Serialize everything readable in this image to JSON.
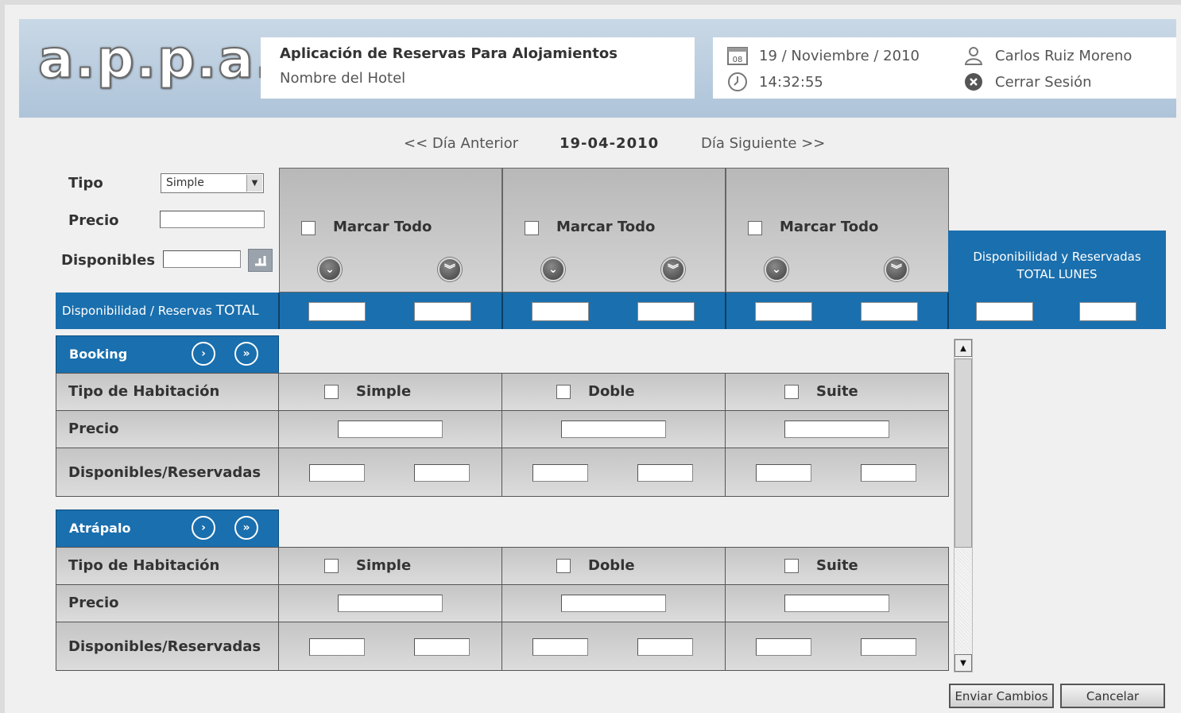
{
  "header": {
    "logo": "a.p.p.a.",
    "app_title": "Aplicación de Reservas Para Alojamientos",
    "hotel_name": "Nombre del Hotel",
    "calendar_day": "08",
    "date": "19 / Noviembre / 2010",
    "time": "14:32:55",
    "user": "Carlos Ruiz Moreno",
    "logout": "Cerrar Sesión"
  },
  "nav": {
    "prev": "<< Día Anterior",
    "date": "19-04-2010",
    "next": "Día Siguiente >>"
  },
  "filter": {
    "tipo_label": "Tipo",
    "tipo_value": "Simple",
    "precio_label": "Precio",
    "disponibles_label": "Disponibles"
  },
  "columns": {
    "mark_all": "Marcar Todo",
    "summary_line1": "Disponibilidad y Reservadas",
    "summary_line2": "TOTAL LUNES"
  },
  "total_bar": {
    "label": "Disponibilidad / Reservas",
    "label_suffix": "TOTAL"
  },
  "channels": [
    {
      "name": "Booking",
      "row_tipo": "Tipo de Habitación",
      "row_precio": "Precio",
      "row_disp": "Disponibles/Reservadas",
      "types": [
        "Simple",
        "Doble",
        "Suite"
      ]
    },
    {
      "name": "Atrápalo",
      "row_tipo": "Tipo de Habitación",
      "row_precio": "Precio",
      "row_disp": "Disponibles/Reservadas",
      "types": [
        "Simple",
        "Doble",
        "Suite"
      ]
    }
  ],
  "buttons": {
    "send": "Enviar Cambios",
    "cancel": "Cancelar"
  },
  "colors": {
    "accent_blue": "#1a6fae",
    "header_blue": "#b8cce0"
  }
}
